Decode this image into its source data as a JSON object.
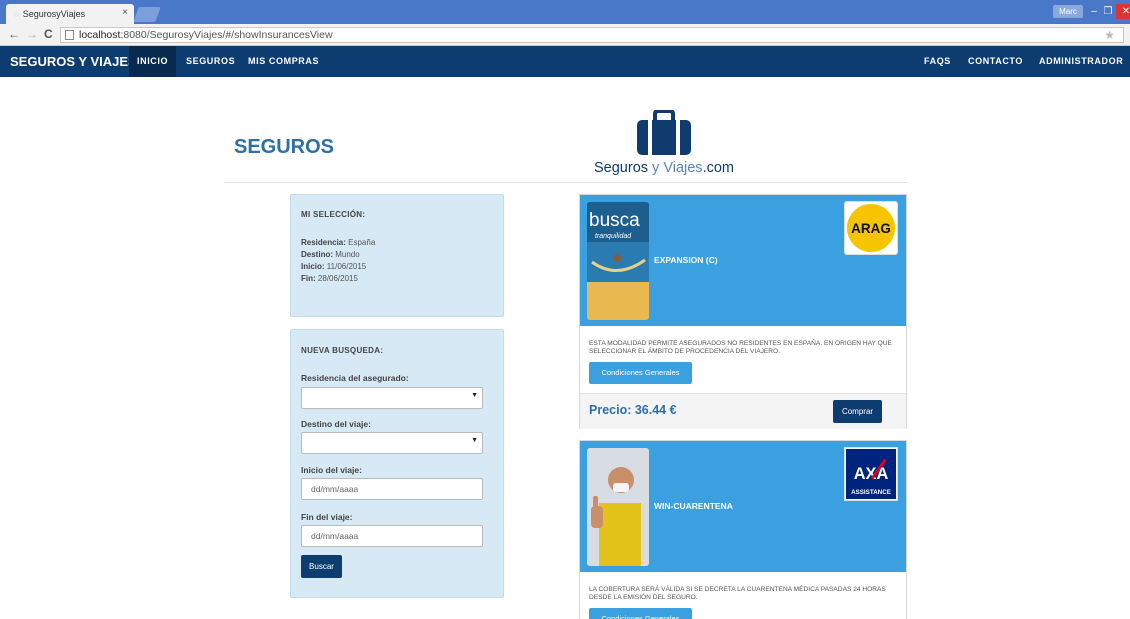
{
  "browser": {
    "tab_title": "SegurosyViajes",
    "tab_close": "×",
    "user": "Marc",
    "url_host": "localhost",
    "url_rest": ":8080/SegurosyViajes/#/showInsurancesView"
  },
  "navbar": {
    "brand": "SEGUROS Y VIAJES",
    "left_links": [
      "INICIO",
      "SEGUROS",
      "MIS COMPRAS"
    ],
    "right_links": [
      "FAQS",
      "CONTACTO",
      "ADMINISTRADOR"
    ],
    "active": "INICIO"
  },
  "page": {
    "title": "SEGUROS",
    "logo_text_a": "Seguros",
    "logo_text_b": " y Viajes",
    "logo_text_c": ".com"
  },
  "seleccion": {
    "heading": "MI SELECCIÓN:",
    "residencia_label": "Residencia:",
    "residencia": "España",
    "destino_label": "Destino:",
    "destino": "Mundo",
    "inicio_label": "Inicio:",
    "inicio": "11/06/2015",
    "fin_label": "Fin:",
    "fin": "28/06/2015"
  },
  "busqueda": {
    "heading": "NUEVA BUSQUEDA:",
    "residencia_label": "Residencia del asegurado:",
    "destino_label": "Destino del viaje:",
    "inicio_label": "Inicio del viaje:",
    "inicio_placeholder": "dd/mm/aaaa",
    "fin_label": "Fin del viaje:",
    "fin_placeholder": "dd/mm/aaaa",
    "button": "Buscar"
  },
  "insurances": [
    {
      "name": "EXPANSION (C)",
      "provider": "ARAG",
      "image_text": "busca",
      "image_subtext": "tranquilidad",
      "description": "ESTA MODALIDAD PERMITE ASEGURADOS NO RESIDENTES EN ESPAÑA. EN ORIGEN HAY QUE SELECCIONAR EL ÁMBITO DE PROCEDENCIA DEL VIAJERO.",
      "conditions_button": "Condiciones Generales",
      "price": "Precio: 36.44 €",
      "buy_button": "Comprar"
    },
    {
      "name": "WIN-CUARENTENA",
      "provider": "AXA",
      "provider_sub": "ASSISTANCE",
      "description": "LA COBERTURA SERÁ VÁLIDA SI SE DECRETA LA CUARENTENA MÉDICA PASADAS 24 HORAS DESDE LA EMISIÓN DEL SEGURO.",
      "conditions_button": "Condiciones Generales"
    }
  ],
  "colors": {
    "navbar": "#0d3d70",
    "accent": "#3aa0df",
    "title": "#2e6fa8",
    "panel": "#d6e9f4"
  }
}
